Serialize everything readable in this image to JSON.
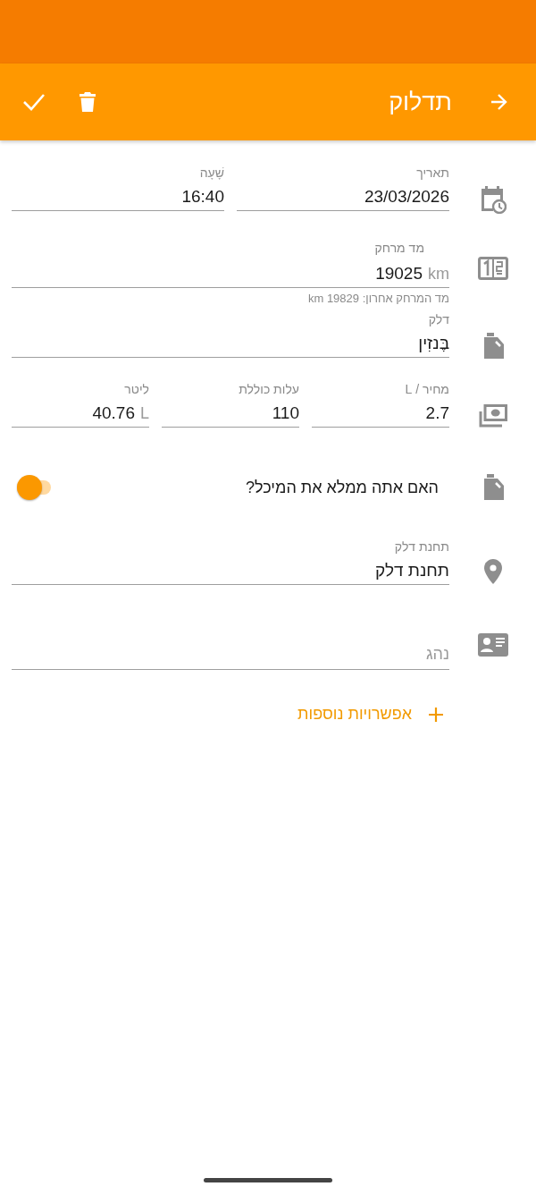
{
  "app_bar": {
    "title": "תדלוק"
  },
  "date_time": [
    {
      "label": "תאריך",
      "value": "23/03/2026"
    },
    {
      "label": "שָׁעָה",
      "value": "16:40"
    }
  ],
  "odometer": {
    "label": "מד מרחק",
    "value": "19025",
    "unit": "km",
    "hint": "מד המרחק אחרון: 19829 km"
  },
  "fuel": {
    "label": "דלק",
    "value": "בֶּנזִין"
  },
  "costs": [
    {
      "label": "מחיר / L",
      "value": "2.7"
    },
    {
      "label": "עלות כוללת",
      "value": "110"
    },
    {
      "label": "ליטר",
      "value": "40.76",
      "unit": "L"
    }
  ],
  "full_tank": {
    "label": "האם אתה ממלא את המיכל?",
    "on": true
  },
  "station": {
    "label": "תחנת דלק",
    "value": "תחנת דלק"
  },
  "driver": {
    "placeholder": "נהג"
  },
  "more_options": {
    "label": "אפשרויות נוספות"
  }
}
